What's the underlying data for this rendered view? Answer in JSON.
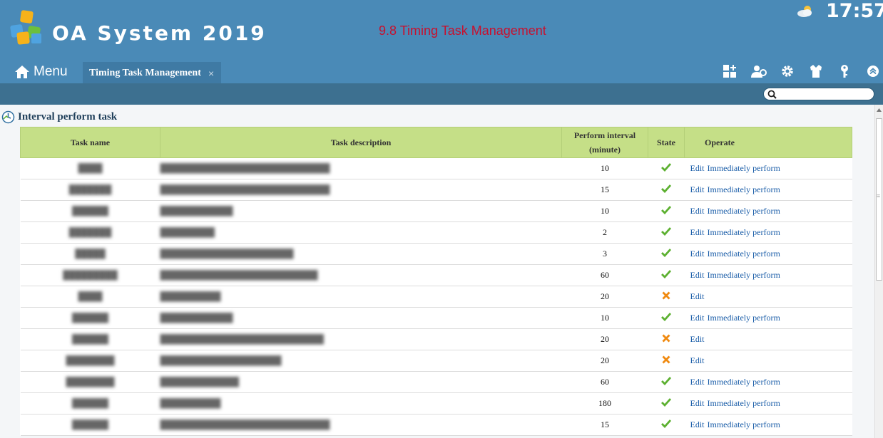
{
  "header": {
    "brand": "OA System 2019",
    "subtitle": "9.8 Timing Task Management",
    "clock": "17:57",
    "weather_icon": "partly-cloudy-icon"
  },
  "nav": {
    "menu_label": "Menu",
    "active_tab": "Timing Task Management",
    "tab_close": "×",
    "tools": [
      "add-module-icon",
      "user-settings-icon",
      "gear-icon",
      "shirt-icon",
      "key-icon",
      "collapse-up-icon"
    ]
  },
  "search": {
    "placeholder": ""
  },
  "section": {
    "title": "Interval perform task"
  },
  "table": {
    "headers": {
      "name": "Task name",
      "desc": "Task description",
      "interval": "Perform interval (minute)",
      "state": "State",
      "operate": "Operate"
    },
    "rows": [
      {
        "name": "████",
        "desc": "████████████████████████████",
        "interval": "10",
        "state": "enabled",
        "ops": [
          "Edit",
          "Immediately perform"
        ]
      },
      {
        "name": "███████",
        "desc": "████████████████████████████",
        "interval": "15",
        "state": "enabled",
        "ops": [
          "Edit",
          "Immediately perform"
        ]
      },
      {
        "name": "██████",
        "desc": "████████████",
        "interval": "10",
        "state": "enabled",
        "ops": [
          "Edit",
          "Immediately perform"
        ]
      },
      {
        "name": "███████",
        "desc": "█████████",
        "interval": "2",
        "state": "enabled",
        "ops": [
          "Edit",
          "Immediately perform"
        ]
      },
      {
        "name": "█████",
        "desc": "██████████████████████",
        "interval": "3",
        "state": "enabled",
        "ops": [
          "Edit",
          "Immediately perform"
        ]
      },
      {
        "name": "█████████",
        "desc": "██████████████████████████",
        "interval": "60",
        "state": "enabled",
        "ops": [
          "Edit",
          "Immediately perform"
        ]
      },
      {
        "name": "████",
        "desc": "██████████",
        "interval": "20",
        "state": "disabled",
        "ops": [
          "Edit"
        ]
      },
      {
        "name": "██████",
        "desc": "████████████",
        "interval": "10",
        "state": "enabled",
        "ops": [
          "Edit",
          "Immediately perform"
        ]
      },
      {
        "name": "██████",
        "desc": "███████████████████████████",
        "interval": "20",
        "state": "disabled",
        "ops": [
          "Edit"
        ]
      },
      {
        "name": "████████",
        "desc": "████████████████████",
        "interval": "20",
        "state": "disabled",
        "ops": [
          "Edit"
        ]
      },
      {
        "name": "████████",
        "desc": "█████████████",
        "interval": "60",
        "state": "enabled",
        "ops": [
          "Edit",
          "Immediately perform"
        ]
      },
      {
        "name": "██████",
        "desc": "██████████",
        "interval": "180",
        "state": "enabled",
        "ops": [
          "Edit",
          "Immediately perform"
        ]
      },
      {
        "name": "██████",
        "desc": "████████████████████████████",
        "interval": "15",
        "state": "enabled",
        "ops": [
          "Edit",
          "Immediately perform"
        ]
      }
    ]
  },
  "colors": {
    "header_bg": "#4a8ab7",
    "table_header_bg": "#c5df87",
    "link": "#1a5da8",
    "check_green": "#5cb030",
    "cross_orange": "#f08a10",
    "subtitle_red": "#c8102e"
  }
}
